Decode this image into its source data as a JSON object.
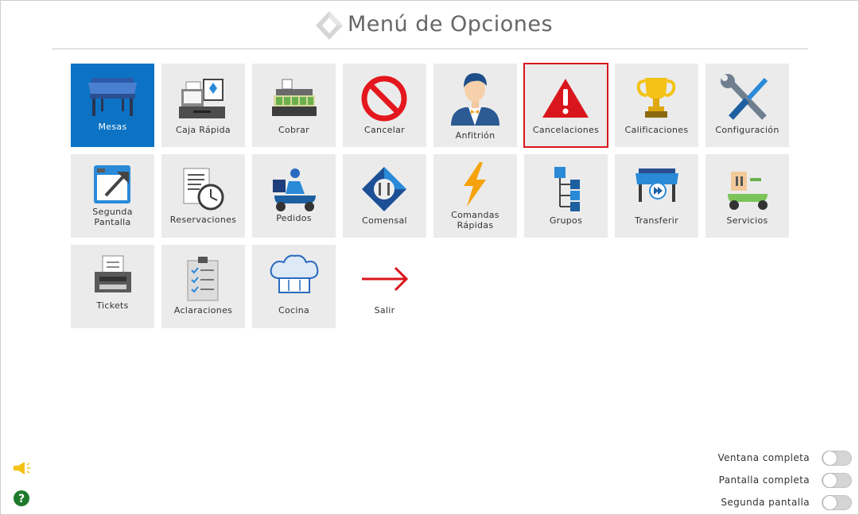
{
  "header": {
    "title": "Menú de Opciones"
  },
  "menu": {
    "items": [
      {
        "id": "mesas",
        "label": "Mesas"
      },
      {
        "id": "caja",
        "label": "Caja Rápida"
      },
      {
        "id": "cobrar",
        "label": "Cobrar"
      },
      {
        "id": "cancelar",
        "label": "Cancelar"
      },
      {
        "id": "anfitrion",
        "label": "Anfitrión"
      },
      {
        "id": "cancelaciones",
        "label": "Cancelaciones"
      },
      {
        "id": "calificaciones",
        "label": "Calificaciones"
      },
      {
        "id": "configuracion",
        "label": "Configuración"
      },
      {
        "id": "segunda",
        "label": "Segunda",
        "label2": "Pantalla"
      },
      {
        "id": "reservaciones",
        "label": "Reservaciones"
      },
      {
        "id": "pedidos",
        "label": "Pedidos"
      },
      {
        "id": "comensal",
        "label": "Comensal"
      },
      {
        "id": "comandas",
        "label": "Comandas",
        "label2": "Rápidas"
      },
      {
        "id": "grupos",
        "label": "Grupos"
      },
      {
        "id": "transferir",
        "label": "Transferir"
      },
      {
        "id": "servicios",
        "label": "Servicios"
      },
      {
        "id": "tickets",
        "label": "Tickets"
      },
      {
        "id": "aclaraciones",
        "label": "Aclaraciones"
      },
      {
        "id": "cocina",
        "label": "Cocina"
      },
      {
        "id": "salir",
        "label": "Salir"
      }
    ]
  },
  "toggles": [
    {
      "label": "Ventana completa",
      "on": false
    },
    {
      "label": "Pantalla completa",
      "on": false
    },
    {
      "label": "Segunda pantalla",
      "on": false
    }
  ],
  "colors": {
    "accent": "#0c73c4",
    "alert": "#d9161c",
    "tile": "#ebebeb"
  },
  "icons": {
    "announce": "megaphone-icon",
    "help": "help-icon"
  }
}
